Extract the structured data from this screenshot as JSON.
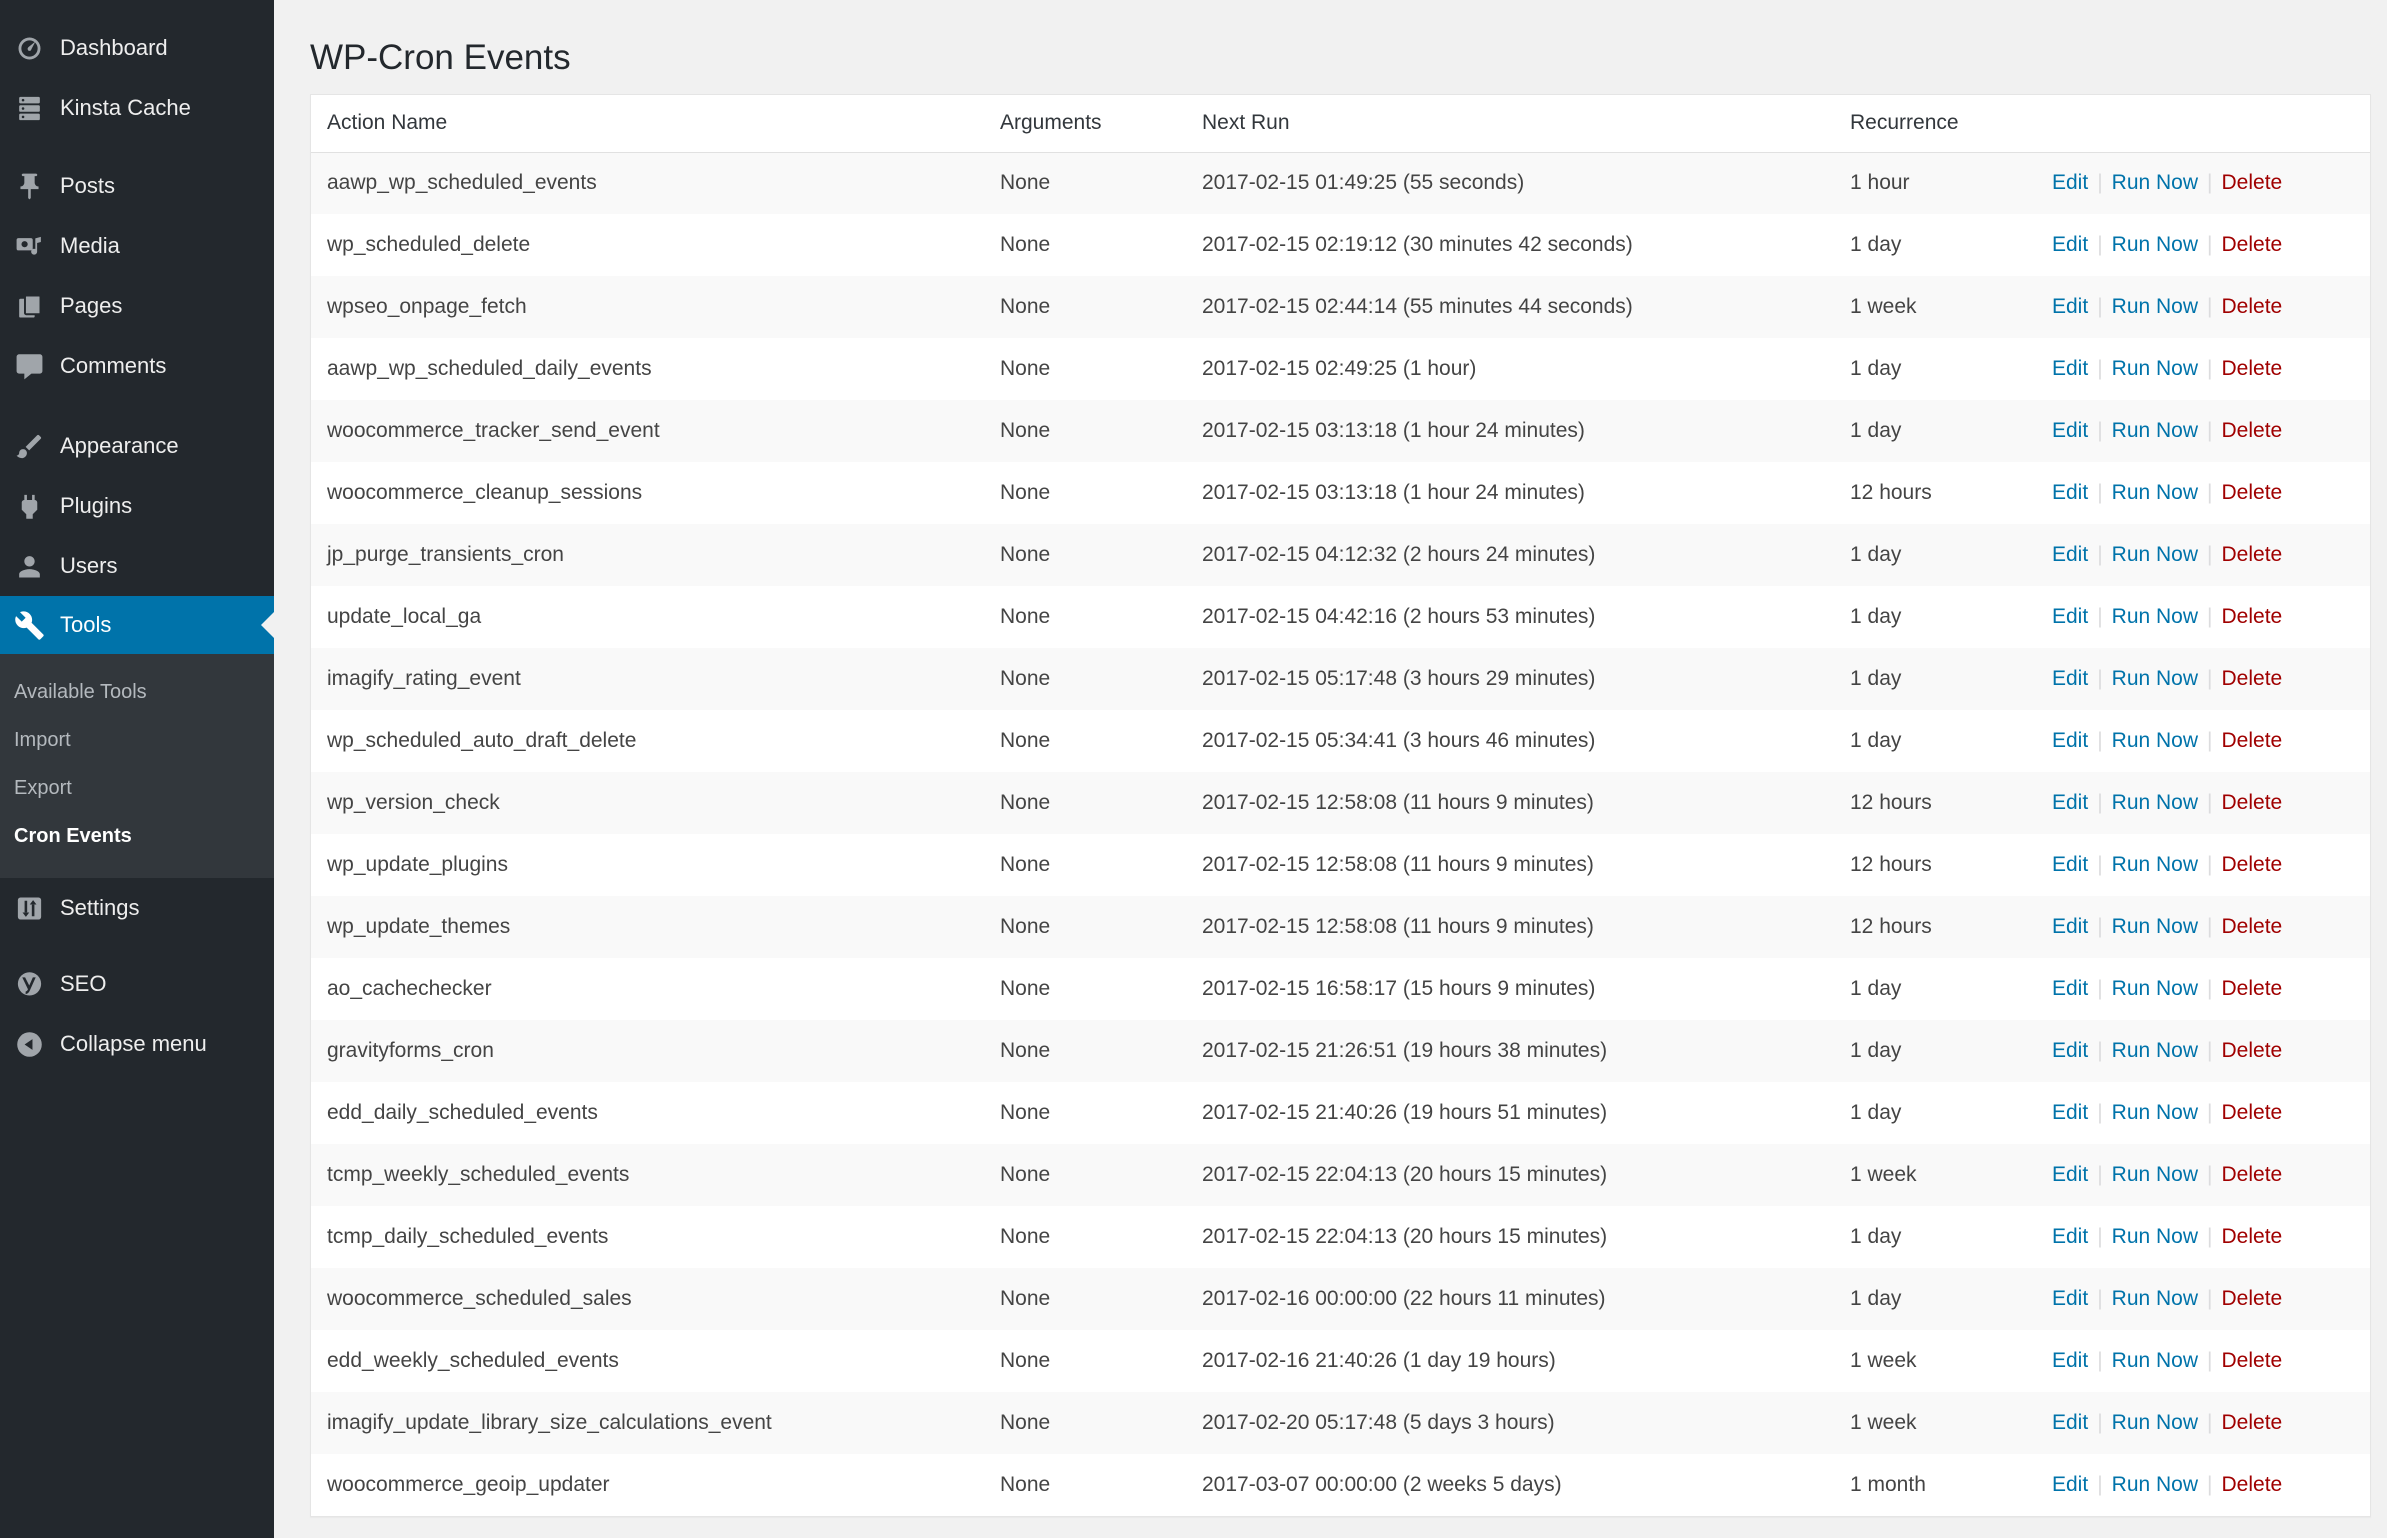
{
  "page": {
    "title": "WP-Cron Events"
  },
  "colors": {
    "sidebar_bg": "#23282d",
    "submenu_bg": "#32373c",
    "active_menu_blue": "#0073aa",
    "content_bg": "#f1f1f1",
    "link_blue": "#0073aa",
    "delete_red": "#a00000",
    "row_stripe": "#f9f9f9"
  },
  "sidebar": {
    "items": {
      "dashboard": {
        "label": "Dashboard",
        "icon": "gauge-icon"
      },
      "kinsta_cache": {
        "label": "Kinsta Cache",
        "icon": "server-icon"
      },
      "posts": {
        "label": "Posts",
        "icon": "pushpin-icon"
      },
      "media": {
        "label": "Media",
        "icon": "camera-icon"
      },
      "pages": {
        "label": "Pages",
        "icon": "pages-icon"
      },
      "comments": {
        "label": "Comments",
        "icon": "comment-bubble-icon"
      },
      "appearance": {
        "label": "Appearance",
        "icon": "paintbrush-icon"
      },
      "plugins": {
        "label": "Plugins",
        "icon": "plug-icon"
      },
      "users": {
        "label": "Users",
        "icon": "person-icon"
      },
      "tools": {
        "label": "Tools",
        "icon": "wrench-icon",
        "active": true
      },
      "settings": {
        "label": "Settings",
        "icon": "sliders-icon"
      },
      "seo": {
        "label": "SEO",
        "icon": "yoast-logo-icon"
      },
      "collapse": {
        "label": "Collapse menu",
        "icon": "collapse-arrow-icon"
      }
    },
    "tools_submenu": [
      {
        "label": "Available Tools"
      },
      {
        "label": "Import"
      },
      {
        "label": "Export"
      },
      {
        "label": "Cron Events",
        "current": true
      }
    ]
  },
  "table": {
    "columns": [
      "Action Name",
      "Arguments",
      "Next Run",
      "Recurrence"
    ],
    "actions": {
      "edit": "Edit",
      "run_now": "Run Now",
      "delete": "Delete",
      "separator": "|"
    },
    "rows": [
      {
        "action_name": "aawp_wp_scheduled_events",
        "arguments": "None",
        "next_run": "2017-02-15 01:49:25 (55 seconds)",
        "recurrence": "1 hour"
      },
      {
        "action_name": "wp_scheduled_delete",
        "arguments": "None",
        "next_run": "2017-02-15 02:19:12 (30 minutes 42 seconds)",
        "recurrence": "1 day"
      },
      {
        "action_name": "wpseo_onpage_fetch",
        "arguments": "None",
        "next_run": "2017-02-15 02:44:14 (55 minutes 44 seconds)",
        "recurrence": "1 week"
      },
      {
        "action_name": "aawp_wp_scheduled_daily_events",
        "arguments": "None",
        "next_run": "2017-02-15 02:49:25 (1 hour)",
        "recurrence": "1 day"
      },
      {
        "action_name": "woocommerce_tracker_send_event",
        "arguments": "None",
        "next_run": "2017-02-15 03:13:18 (1 hour 24 minutes)",
        "recurrence": "1 day"
      },
      {
        "action_name": "woocommerce_cleanup_sessions",
        "arguments": "None",
        "next_run": "2017-02-15 03:13:18 (1 hour 24 minutes)",
        "recurrence": "12 hours"
      },
      {
        "action_name": "jp_purge_transients_cron",
        "arguments": "None",
        "next_run": "2017-02-15 04:12:32 (2 hours 24 minutes)",
        "recurrence": "1 day"
      },
      {
        "action_name": "update_local_ga",
        "arguments": "None",
        "next_run": "2017-02-15 04:42:16 (2 hours 53 minutes)",
        "recurrence": "1 day"
      },
      {
        "action_name": "imagify_rating_event",
        "arguments": "None",
        "next_run": "2017-02-15 05:17:48 (3 hours 29 minutes)",
        "recurrence": "1 day"
      },
      {
        "action_name": "wp_scheduled_auto_draft_delete",
        "arguments": "None",
        "next_run": "2017-02-15 05:34:41 (3 hours 46 minutes)",
        "recurrence": "1 day"
      },
      {
        "action_name": "wp_version_check",
        "arguments": "None",
        "next_run": "2017-02-15 12:58:08 (11 hours 9 minutes)",
        "recurrence": "12 hours"
      },
      {
        "action_name": "wp_update_plugins",
        "arguments": "None",
        "next_run": "2017-02-15 12:58:08 (11 hours 9 minutes)",
        "recurrence": "12 hours"
      },
      {
        "action_name": "wp_update_themes",
        "arguments": "None",
        "next_run": "2017-02-15 12:58:08 (11 hours 9 minutes)",
        "recurrence": "12 hours"
      },
      {
        "action_name": "ao_cachechecker",
        "arguments": "None",
        "next_run": "2017-02-15 16:58:17 (15 hours 9 minutes)",
        "recurrence": "1 day"
      },
      {
        "action_name": "gravityforms_cron",
        "arguments": "None",
        "next_run": "2017-02-15 21:26:51 (19 hours 38 minutes)",
        "recurrence": "1 day"
      },
      {
        "action_name": "edd_daily_scheduled_events",
        "arguments": "None",
        "next_run": "2017-02-15 21:40:26 (19 hours 51 minutes)",
        "recurrence": "1 day"
      },
      {
        "action_name": "tcmp_weekly_scheduled_events",
        "arguments": "None",
        "next_run": "2017-02-15 22:04:13 (20 hours 15 minutes)",
        "recurrence": "1 week"
      },
      {
        "action_name": "tcmp_daily_scheduled_events",
        "arguments": "None",
        "next_run": "2017-02-15 22:04:13 (20 hours 15 minutes)",
        "recurrence": "1 day"
      },
      {
        "action_name": "woocommerce_scheduled_sales",
        "arguments": "None",
        "next_run": "2017-02-16 00:00:00 (22 hours 11 minutes)",
        "recurrence": "1 day"
      },
      {
        "action_name": "edd_weekly_scheduled_events",
        "arguments": "None",
        "next_run": "2017-02-16 21:40:26 (1 day 19 hours)",
        "recurrence": "1 week"
      },
      {
        "action_name": "imagify_update_library_size_calculations_event",
        "arguments": "None",
        "next_run": "2017-02-20 05:17:48 (5 days 3 hours)",
        "recurrence": "1 week"
      },
      {
        "action_name": "woocommerce_geoip_updater",
        "arguments": "None",
        "next_run": "2017-03-07 00:00:00 (2 weeks 5 days)",
        "recurrence": "1 month"
      }
    ]
  }
}
